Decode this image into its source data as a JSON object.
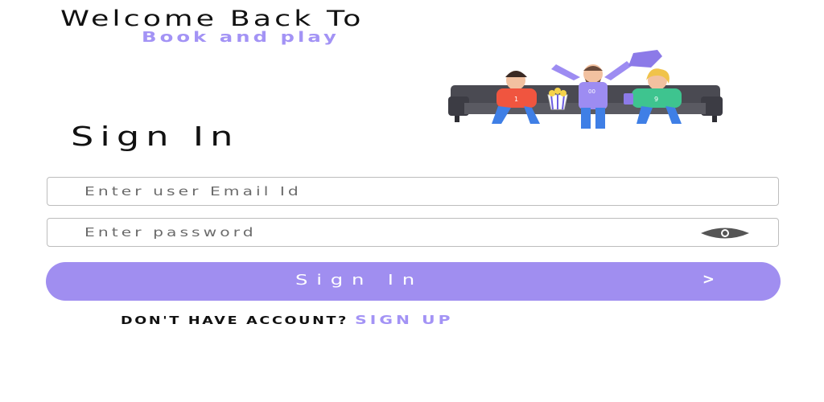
{
  "header": {
    "welcome": "Welcome Back To",
    "brand": "Book and play"
  },
  "form": {
    "title": "Sign In",
    "email_placeholder": "Enter user Email Id",
    "password_placeholder": "Enter password",
    "submit_label": "Sign In",
    "submit_arrow": ">"
  },
  "footer": {
    "question": "DON'T HAVE ACCOUNT?",
    "signup_link": "SIGN UP"
  },
  "illustration": {
    "icon": "friends-on-sofa-illustration",
    "jersey_numbers": [
      "1",
      "00",
      "9"
    ]
  },
  "colors": {
    "accent": "#a08ef0",
    "brand_text": "#a393f5",
    "sofa": "#4a4a52"
  }
}
